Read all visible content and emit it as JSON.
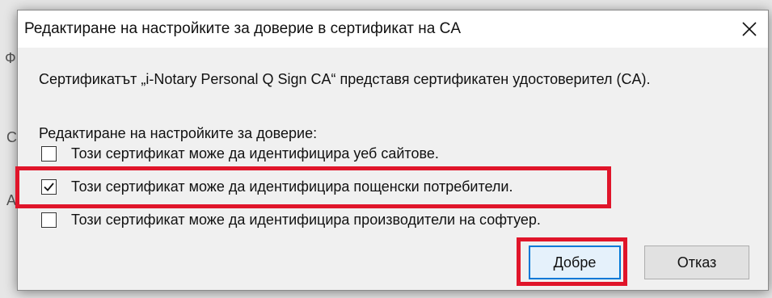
{
  "background": {
    "glyphs": [
      "Ф",
      "С",
      "А"
    ]
  },
  "dialog": {
    "title": "Редактиране на настройките за доверие в сертификат на CA",
    "description": "Сертификатът „i-Notary Personal Q Sign CA“ представя сертификатен удостоверител (CA).",
    "section_label": "Редактиране на настройките за доверие:",
    "options": [
      {
        "label": "Този сертификат може да идентифицира уеб сайтове.",
        "checked": false
      },
      {
        "label": "Този сертификат може да идентифицира пощенски потребители.",
        "checked": true
      },
      {
        "label": "Този сертификат може да идентифицира производители на софтуер.",
        "checked": false
      }
    ],
    "buttons": {
      "ok": "Добре",
      "cancel": "Отказ"
    }
  },
  "colors": {
    "highlight": "#e0152a",
    "accent": "#0078d7"
  },
  "icons": {
    "close": "close-icon",
    "check": "checkmark-icon"
  }
}
